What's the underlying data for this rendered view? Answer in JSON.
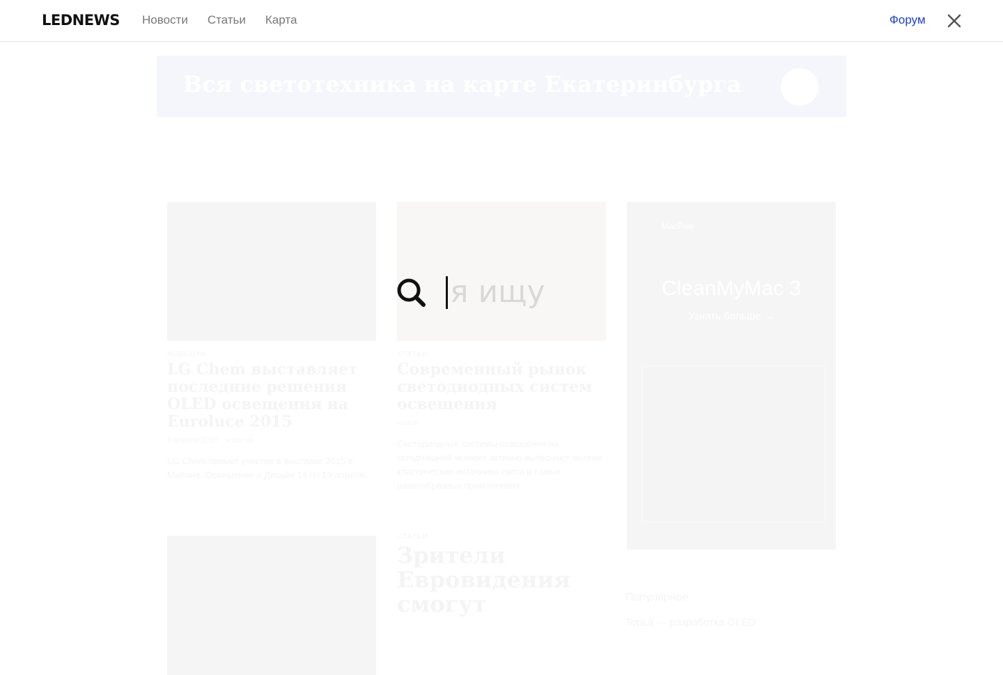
{
  "header": {
    "logo": "LEDNEWS",
    "nav": [
      "Новости",
      "Статьи",
      "Карта"
    ],
    "forum_label": "Форум",
    "accent_color": "#1a3fd6"
  },
  "search": {
    "placeholder": "я ищу",
    "value": ""
  },
  "background_page": {
    "banner_title": "Вся светотехника на карте Екатеринбурга",
    "cards": [
      {
        "category": "новости",
        "title": "LG Chem выставляет последние решения OLED освещения на Euroluce 2015",
        "meta": "9 апреля 2015 · новости",
        "text": "LG Chem примет участие в выставке 2015 в Милане. Освещение и Дизайн 14 по 19 апреля."
      },
      {
        "category": "статьи",
        "title": "Современный рынок светодиодных систем освещения",
        "meta": "новое",
        "text": "Светодиодные системы освещения на сегодняшний момент активно вытесняют многие классические источники света в самых разнообразных применениях."
      },
      {
        "category": "",
        "title": "",
        "meta": "",
        "text": ""
      },
      {
        "category": "статьи",
        "title": "Зрители Евровидения смогут",
        "meta": "",
        "text": ""
      }
    ],
    "ad": {
      "brand": "MacPaw",
      "title": "CleanMyMac 3",
      "subtitle": "Узнать больше →"
    },
    "popular_heading": "Популярное",
    "popular_item": "TopLit — разработка OLED"
  }
}
